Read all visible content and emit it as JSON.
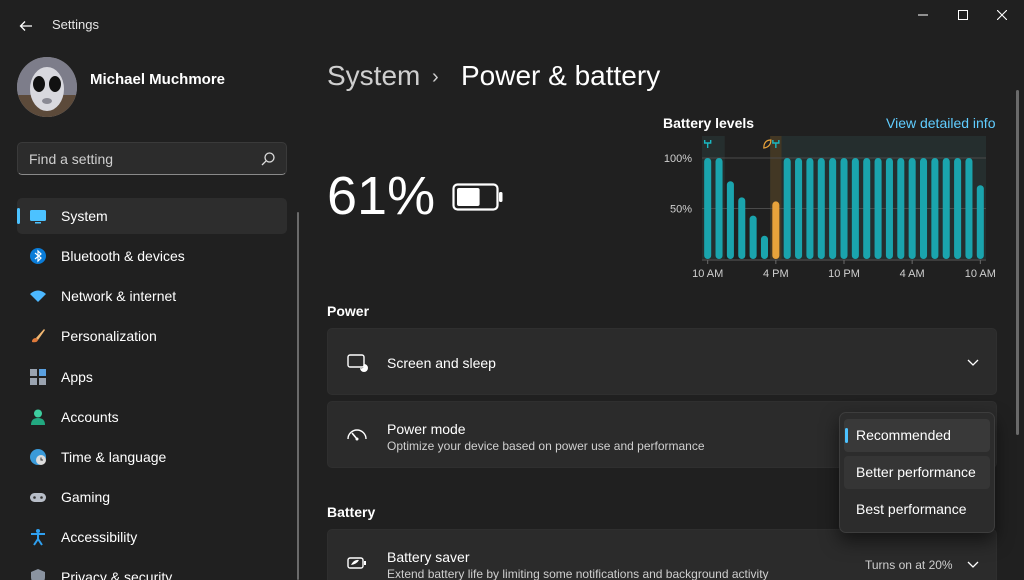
{
  "window": {
    "title": "Settings"
  },
  "user": {
    "name": "Michael Muchmore"
  },
  "search": {
    "placeholder": "Find a setting"
  },
  "sidebar": {
    "items": [
      {
        "label": "System",
        "icon": "system-icon",
        "active": true
      },
      {
        "label": "Bluetooth & devices",
        "icon": "bluetooth-icon"
      },
      {
        "label": "Network & internet",
        "icon": "wifi-icon"
      },
      {
        "label": "Personalization",
        "icon": "brush-icon"
      },
      {
        "label": "Apps",
        "icon": "apps-icon"
      },
      {
        "label": "Accounts",
        "icon": "accounts-icon"
      },
      {
        "label": "Time & language",
        "icon": "globe-clock-icon"
      },
      {
        "label": "Gaming",
        "icon": "gamepad-icon"
      },
      {
        "label": "Accessibility",
        "icon": "accessibility-icon"
      },
      {
        "label": "Privacy & security",
        "icon": "shield-icon"
      }
    ]
  },
  "breadcrumb": {
    "parent": "System",
    "separator": "›",
    "current": "Power & battery"
  },
  "battery": {
    "percent": "61%",
    "level_fraction": 0.61
  },
  "chart": {
    "title": "Battery levels",
    "link": "View detailed info"
  },
  "chart_data": {
    "type": "bar",
    "title": "Battery levels",
    "y_ticks": [
      "100%",
      "50%"
    ],
    "x_ticks": [
      "10 AM",
      "4 PM",
      "10 PM",
      "4 AM",
      "10 AM"
    ],
    "ylim": [
      0,
      100
    ],
    "values": [
      100,
      100,
      77,
      61,
      43,
      23,
      57,
      100,
      100,
      100,
      100,
      100,
      100,
      100,
      100,
      100,
      100,
      100,
      100,
      100,
      100,
      100,
      100,
      100,
      73
    ],
    "highlight_index": 6,
    "colors": {
      "normal": "#1aa4ad",
      "highlight": "#e8a33b",
      "band": "#2a3a3a"
    },
    "plug_markers": [
      {
        "bar_index": 0,
        "icon": "plug-icon"
      },
      {
        "bar_index": 6,
        "icon": "leaf-plug-icon"
      }
    ]
  },
  "power_section": {
    "title": "Power"
  },
  "screen_sleep": {
    "title": "Screen and sleep"
  },
  "power_mode": {
    "title": "Power mode",
    "subtitle": "Optimize your device based on power use and performance",
    "options": [
      "Recommended",
      "Better performance",
      "Best performance"
    ],
    "selected_index": 0,
    "hover_index": 1
  },
  "battery_section": {
    "title": "Battery"
  },
  "battery_saver": {
    "title": "Battery saver",
    "subtitle": "Extend battery life by limiting some notifications and background activity",
    "value": "Turns on at 20%"
  },
  "accent": "#4cc2ff"
}
